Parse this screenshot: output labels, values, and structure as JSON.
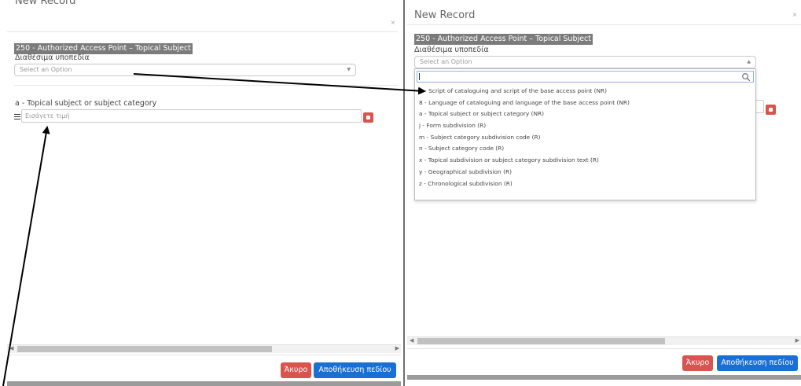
{
  "left": {
    "title": "New Record",
    "close": "×",
    "field_badge": "250 - Authorized Access Point – Topical Subject",
    "subfields_label": "Διαθέσιμα υποπεδία",
    "select_placeholder": "Select an Option",
    "select_arrow": "▼",
    "subfield_label": "a - Topical subject or subject category",
    "input_placeholder": "Εισάγετε τιμή",
    "cancel": "Άκυρο",
    "save": "Αποθήκευση πεδίου"
  },
  "right": {
    "title": "New Record",
    "close": "×",
    "field_badge": "250 - Authorized Access Point – Topical Subject",
    "subfields_label": "Διαθέσιμα υποπεδία",
    "select_placeholder": "Select an Option",
    "select_arrow": "▲",
    "cancel": "Άκυρο",
    "save": "Αποθήκευση πεδίου",
    "options": [
      "7 - Script of cataloguing and script of the base access point (NR)",
      "8 - Language of cataloguing and language of the base access point (NR)",
      "a - Topical subject or subject category (NR)",
      "j - Form subdivision (R)",
      "m - Subject category subdivision code (R)",
      "n - Subject category code (R)",
      "x - Topical subdivision or subject category subdivision text (R)",
      "y - Geographical subdivision (R)",
      "z - Chronological subdivision (R)"
    ]
  },
  "colors": {
    "cancel": "#d9534f",
    "save": "#1a6fd4",
    "badge": "#7b7b7b",
    "arrow": "#000000"
  },
  "icons": [
    "close-icon",
    "chevron-down-icon",
    "chevron-up-icon",
    "drag-handle-icon",
    "delete-icon",
    "search-icon",
    "scroll-left-icon",
    "scroll-right-icon"
  ]
}
